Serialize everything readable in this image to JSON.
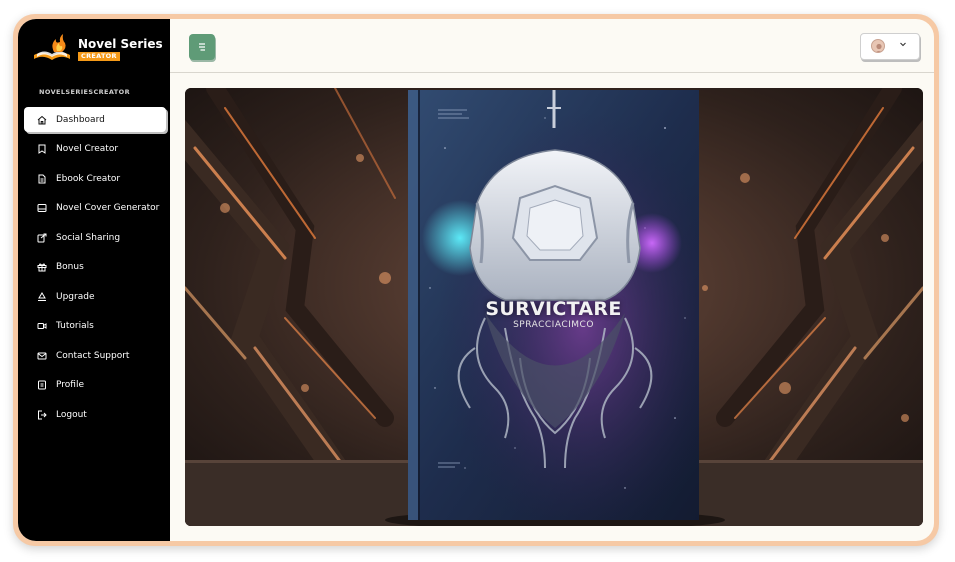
{
  "sidebar": {
    "logo": {
      "title": "Novel Series",
      "subtitle": "CREATOR"
    },
    "brand_label": "NOVELSERIESCREATOR",
    "items": [
      {
        "label": "Dashboard",
        "icon": "home-icon",
        "active": true
      },
      {
        "label": "Novel Creator",
        "icon": "bookmark-icon"
      },
      {
        "label": "Ebook Creator",
        "icon": "document-icon"
      },
      {
        "label": "Novel Cover Generator",
        "icon": "image-icon"
      },
      {
        "label": "Social Sharing",
        "icon": "share-icon"
      },
      {
        "label": "Bonus",
        "icon": "gift-icon"
      },
      {
        "label": "Upgrade",
        "icon": "recycle-icon"
      },
      {
        "label": "Tutorials",
        "icon": "video-icon"
      },
      {
        "label": "Contact Support",
        "icon": "mail-icon"
      },
      {
        "label": "Profile",
        "icon": "profile-icon"
      },
      {
        "label": "Logout",
        "icon": "logout-icon"
      }
    ]
  },
  "topbar": {
    "menu_icon": "menu-icon",
    "user_icon": "avatar-icon",
    "dropdown_icon": "chevron-down-icon"
  },
  "hero": {
    "book_title": "SURVICTARE",
    "book_subtitle": "SPRACCIACIMCO"
  },
  "colors": {
    "sidebar_bg": "#000000",
    "accent_green": "#5f9b77",
    "frame": "#f6c9a5",
    "logo_badge": "#f59a18"
  }
}
